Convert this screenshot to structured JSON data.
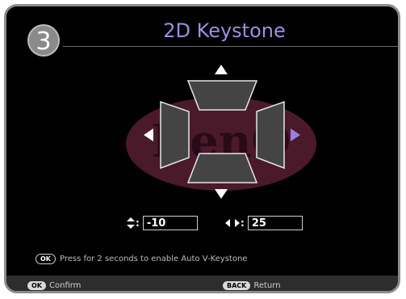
{
  "window": {
    "step_number": "3",
    "title": "2D Keystone"
  },
  "logo_text": "BenQ",
  "values": {
    "vertical_value": "-10",
    "horizontal_value": "25",
    "vertical_icon": "updown-arrows-icon",
    "horizontal_icon": "leftright-arrows-icon",
    "colon": ":"
  },
  "hint": {
    "badge": "OK",
    "text": "Press for 2 seconds to enable Auto V-Keystone"
  },
  "footer": {
    "confirm_badge": "OK",
    "confirm_label": "Confirm",
    "return_badge": "BACK",
    "return_label": "Return"
  },
  "colors": {
    "title": "#a28be0",
    "active_arrow": "#9c7de6",
    "background": "#000000"
  }
}
